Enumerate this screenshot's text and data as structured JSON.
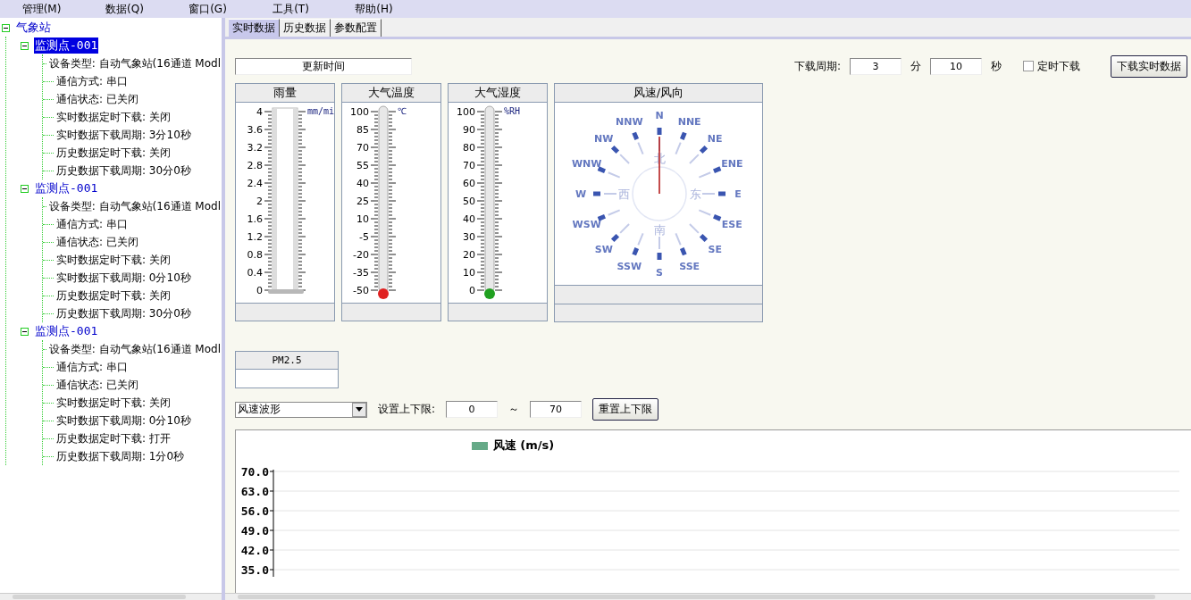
{
  "menu": [
    "管理(M)",
    "数据(Q)",
    "窗口(G)",
    "工具(T)",
    "帮助(H)"
  ],
  "tree": {
    "label": "气象站",
    "expanded": true,
    "selected": false,
    "children": [
      {
        "label": "监测点-001",
        "expanded": true,
        "selected": true,
        "children": [
          {
            "label": "设备类型: 自动气象站(16通道 Modl"
          },
          {
            "label": "通信方式: 串口"
          },
          {
            "label": "通信状态: 已关闭"
          },
          {
            "label": "实时数据定时下载: 关闭"
          },
          {
            "label": "实时数据下载周期: 3分10秒"
          },
          {
            "label": "历史数据定时下载: 关闭"
          },
          {
            "label": "历史数据下载周期: 30分0秒"
          }
        ]
      },
      {
        "label": "监测点-001",
        "expanded": true,
        "selected": false,
        "children": [
          {
            "label": "设备类型: 自动气象站(16通道 Modl"
          },
          {
            "label": "通信方式: 串口"
          },
          {
            "label": "通信状态: 已关闭"
          },
          {
            "label": "实时数据定时下载: 关闭"
          },
          {
            "label": "实时数据下载周期: 0分10秒"
          },
          {
            "label": "历史数据定时下载: 关闭"
          },
          {
            "label": "历史数据下载周期: 30分0秒"
          }
        ]
      },
      {
        "label": "监测点-001",
        "expanded": true,
        "selected": false,
        "children": [
          {
            "label": "设备类型: 自动气象站(16通道 Modl"
          },
          {
            "label": "通信方式: 串口"
          },
          {
            "label": "通信状态: 已关闭"
          },
          {
            "label": "实时数据定时下载: 关闭"
          },
          {
            "label": "实时数据下载周期: 0分10秒"
          },
          {
            "label": "历史数据定时下载: 打开"
          },
          {
            "label": "历史数据下载周期: 1分0秒"
          }
        ]
      }
    ]
  },
  "tabs": [
    {
      "label": "实时数据",
      "selected": true
    },
    {
      "label": "历史数据",
      "selected": false
    },
    {
      "label": "参数配置",
      "selected": false
    }
  ],
  "update_time": {
    "label": "更新时间"
  },
  "download": {
    "label": "下载周期:",
    "minutes": "3",
    "minutes_unit": "分",
    "seconds": "10",
    "seconds_unit": "秒",
    "timer": {
      "label": "定时下载",
      "checked": false
    },
    "button": "下载实时数据"
  },
  "gauges": [
    {
      "title": "雨量",
      "kind": "bar",
      "unit": "mm/mi",
      "level": 0,
      "color": "#b8b8b8",
      "scale": [
        "4",
        "3.6",
        "3.2",
        "2.8",
        "2.4",
        "2",
        "1.6",
        "1.2",
        "0.8",
        "0.4",
        "0"
      ]
    },
    {
      "title": "大气温度",
      "kind": "bulb",
      "unit": "℃",
      "level": 0,
      "color": "#e02020",
      "scale": [
        "100",
        "85",
        "70",
        "55",
        "40",
        "25",
        "10",
        "-5",
        "-20",
        "-35",
        "-50"
      ]
    },
    {
      "title": "大气湿度",
      "kind": "bulb",
      "unit": "%RH",
      "level": 0,
      "color": "#20a020",
      "scale": [
        "100",
        "90",
        "80",
        "70",
        "60",
        "50",
        "40",
        "30",
        "20",
        "10",
        "0"
      ]
    }
  ],
  "wind": {
    "title": "风速/风向",
    "directions": [
      "N",
      "NNW",
      "NNE",
      "NW",
      "NE",
      "WNW",
      "ENE",
      "W",
      "E",
      "WSW",
      "ESE",
      "SW",
      "SE",
      "SSW",
      "SSE",
      "S"
    ],
    "cardinals": [
      "北",
      "东",
      "南",
      "西"
    ]
  },
  "pm25": {
    "title": "PM2.5"
  },
  "chart_controls": {
    "dropdown": "风速波形",
    "limit_label": "设置上下限:",
    "lower": "0",
    "separator": "～",
    "upper": "70",
    "reset_button": "重置上下限"
  },
  "chart": {
    "chart_data": {
      "type": "line",
      "ylim": [
        35,
        70
      ],
      "grid": true,
      "series": [
        {
          "name": "风速 (m/s)",
          "color": "#66aa88"
        }
      ],
      "yticks": [
        {
          "value": 70,
          "label": "70.0"
        },
        {
          "value": 63,
          "label": "63.0"
        },
        {
          "value": 56,
          "label": "56.0"
        },
        {
          "value": 49,
          "label": "49.0"
        },
        {
          "value": 42,
          "label": "42.0"
        },
        {
          "value": 35,
          "label": "35.0"
        }
      ]
    }
  }
}
